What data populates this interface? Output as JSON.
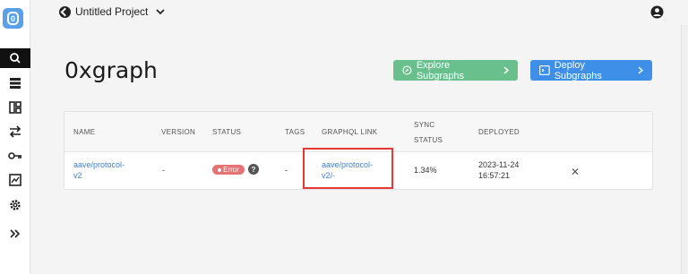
{
  "sidebar": {
    "logo": "0",
    "icons": [
      "search-icon",
      "database-icon",
      "layout-icon",
      "swap-icon",
      "key-icon",
      "chart-icon",
      "gear-icon",
      "expand-icon"
    ]
  },
  "topbar": {
    "project_name": "Untitled Project"
  },
  "page": {
    "title": "0xgraph",
    "explore_label": "Explore Subgraphs",
    "deploy_label": "Deploy Subgraphs"
  },
  "table": {
    "headers": {
      "name": "NAME",
      "version": "VERSION",
      "status": "STATUS",
      "tags": "TAGS",
      "graphql": "GRAPHQL LINK",
      "sync_line1": "SYNC",
      "sync_line2": "STATUS",
      "deployed": "DEPLOYED"
    },
    "row": {
      "name_line1": "aave/protocol-",
      "name_line2": "v2",
      "version": "-",
      "status": "Error",
      "tags": "-",
      "graphql_line1": "aave/protocol-",
      "graphql_line2": "v2/-",
      "sync": "1.34%",
      "deployed_line1": "2023-11-24",
      "deployed_line2": "16:57:21",
      "remove": "✕"
    }
  },
  "colors": {
    "explore": "#69c08d",
    "deploy": "#3d8fe8",
    "error": "#e57373",
    "highlight": "#e53935"
  }
}
